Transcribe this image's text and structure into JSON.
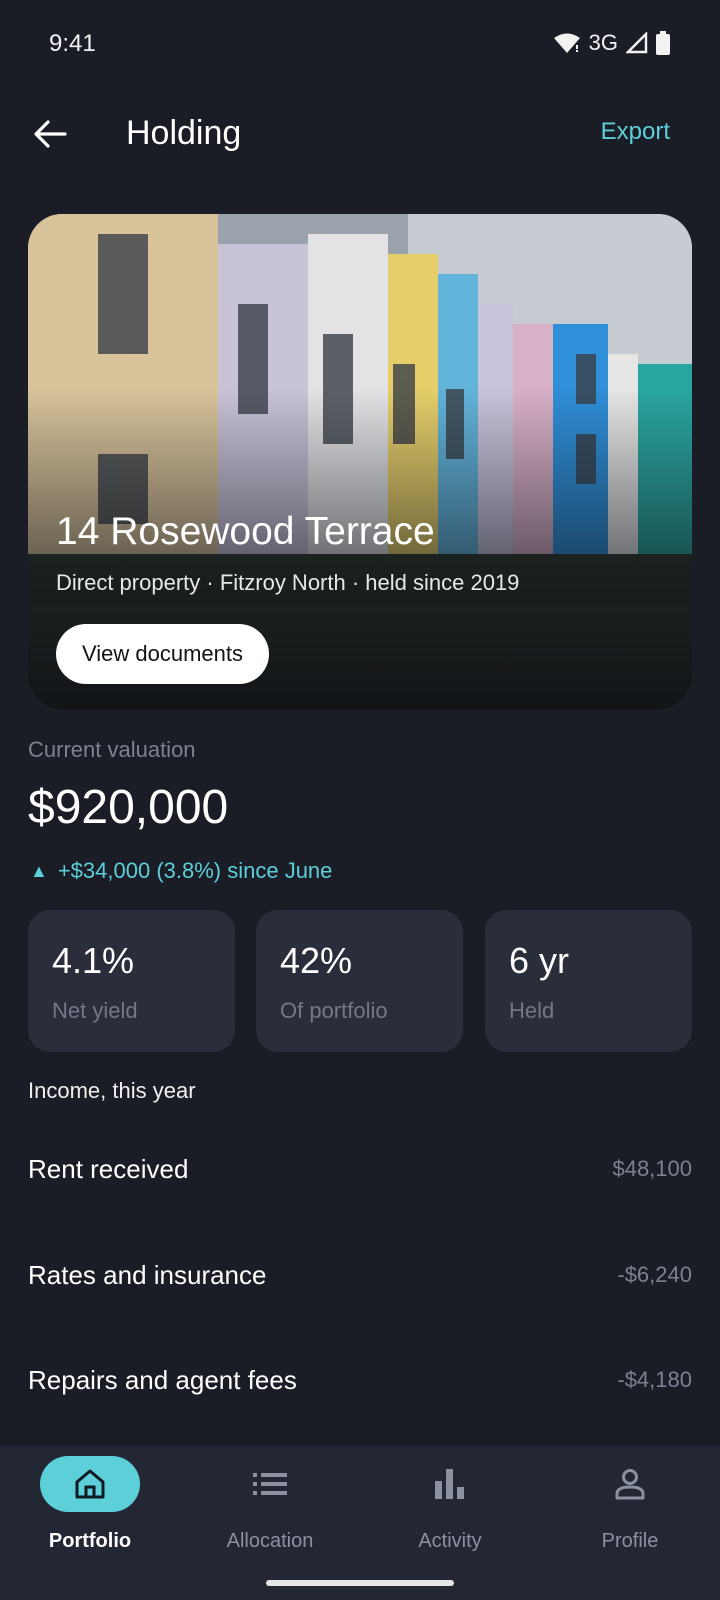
{
  "status_bar": {
    "time": "9:41",
    "network": "3G"
  },
  "app_bar": {
    "title": "Holding",
    "export_label": "Export",
    "back_icon": "arrow-left-icon"
  },
  "hero": {
    "title": "14 Rosewood Terrace",
    "subtitle": "Direct property · Fitzroy North · held since 2019",
    "button_label": "View documents"
  },
  "valuation": {
    "label": "Current valuation",
    "amount": "$920,000",
    "change_arrow": "▲",
    "change": "+$34,000 (3.8%) since June"
  },
  "stats": [
    {
      "value": "4.1%",
      "label": "Net yield"
    },
    {
      "value": "42%",
      "label": "Of portfolio"
    },
    {
      "value": "6 yr",
      "label": "Held"
    }
  ],
  "income": {
    "heading": "Income, this year",
    "rows": [
      {
        "label": "Rent received",
        "amount": "$48,100"
      },
      {
        "label": "Rates and insurance",
        "amount": "-$6,240"
      },
      {
        "label": "Repairs and agent fees",
        "amount": "-$4,180"
      }
    ]
  },
  "nav": [
    {
      "label": "Portfolio",
      "icon": "home-icon",
      "active": true
    },
    {
      "label": "Allocation",
      "icon": "list-icon",
      "active": false
    },
    {
      "label": "Activity",
      "icon": "bar-chart-icon",
      "active": false
    },
    {
      "label": "Profile",
      "icon": "person-icon",
      "active": false
    }
  ],
  "colors": {
    "background": "#1a1c26",
    "accent": "#5ccfd9",
    "card": "#2a2d3a"
  }
}
